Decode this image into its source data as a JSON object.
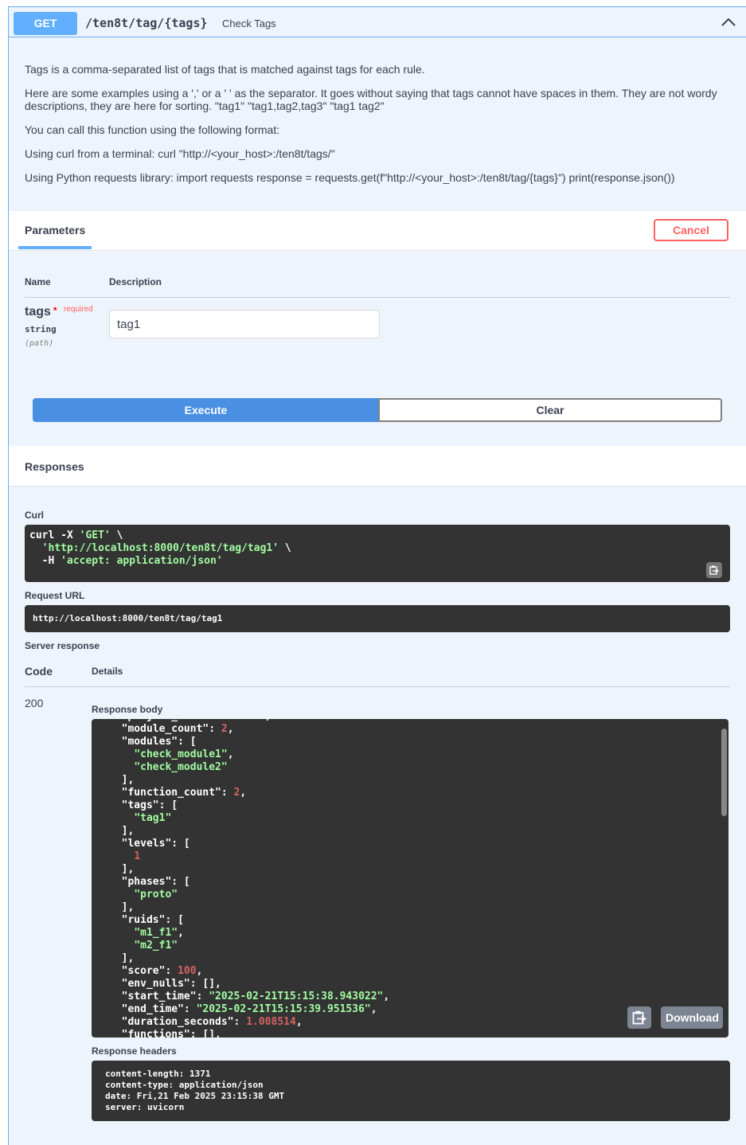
{
  "summary": {
    "method": "GET",
    "path": "/ten8t/tag/{tags}",
    "description": "Check Tags"
  },
  "description": [
    "Tags is a comma-separated list of tags that is matched against tags for each rule.",
    "Here are some examples using a ',' or a ' ' as the separator. It goes without saying that tags cannot have spaces in them. They are not wordy descriptions, they are here for sorting. \"tag1\" \"tag1,tag2,tag3\" \"tag1 tag2\"",
    "You can call this function using the following format:",
    "Using curl from a terminal: curl \"http://<your_host>:/ten8t/tags/\"",
    "Using Python requests library: import requests response = requests.get(f\"http://<your_host>:/ten8t/tag/{tags}\") print(response.json())"
  ],
  "parameters": {
    "tab_label": "Parameters",
    "cancel_label": "Cancel",
    "col_name": "Name",
    "col_description": "Description",
    "param": {
      "name": "tags",
      "required_marker": "*",
      "required_label": "required",
      "type": "string",
      "in": "(path)",
      "value": "tag1"
    },
    "execute_label": "Execute",
    "clear_label": "Clear"
  },
  "responses": {
    "title": "Responses",
    "curl_label": "Curl",
    "curl": {
      "line1_cmd": "curl -X ",
      "line1_str": "'GET'",
      "line1_end": " \\",
      "line2_str": "'http://localhost:8000/ten8t/tag/tag1'",
      "line2_end": " \\",
      "line3_cmd": "-H ",
      "line3_str": "'accept: application/json'"
    },
    "request_url_label": "Request URL",
    "request_url": "http://localhost:8000/ten8t/tag/tag1",
    "server_response_label": "Server response",
    "code_header": "Code",
    "details_header": "Details",
    "code": "200",
    "response_body_label": "Response body",
    "download_label": "Download",
    "response_headers_label": "Response headers",
    "headers": [
      "content-length: 1371",
      "content-type: application/json",
      "date: Fri,21 Feb 2025 23:15:38 GMT",
      "server: uvicorn"
    ]
  }
}
